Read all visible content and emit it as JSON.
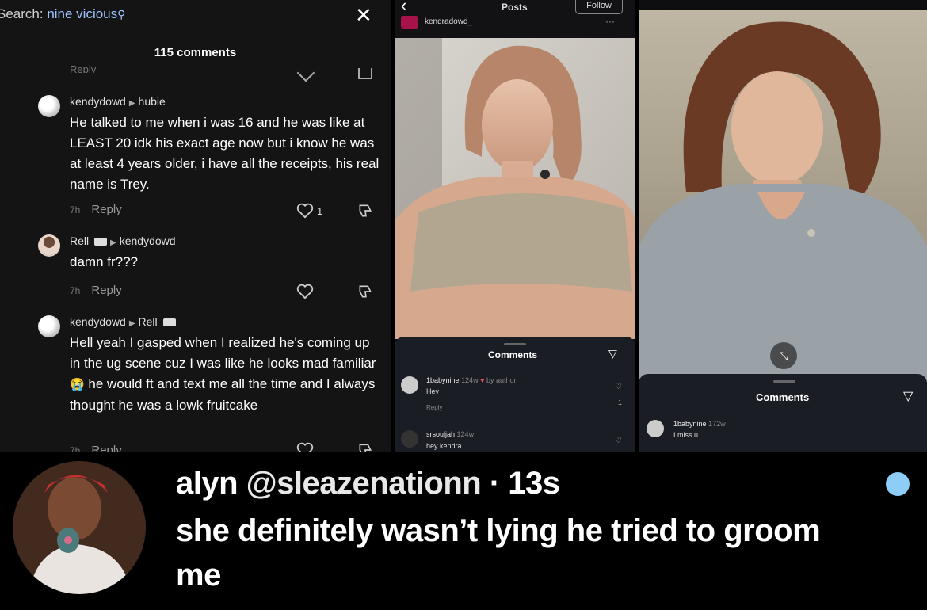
{
  "left_panel": {
    "search_prefix": "Search: ",
    "search_query": "nine vicious",
    "comments_count": "115 comments",
    "cut_off_reply": "Reply",
    "comments": [
      {
        "author": "kendydowd",
        "reply_to": "hubie",
        "text": "He talked to me when i was 16 and he was like at LEAST 20 idk his exact age now but i know he was at least 4 years older, i have all the receipts, his real name is Trey.",
        "time": "7h",
        "reply_label": "Reply",
        "likes": "1"
      },
      {
        "author": "Rell",
        "reply_to": "kendydowd",
        "text": "damn fr???",
        "time": "7h",
        "reply_label": "Reply"
      },
      {
        "author": "kendydowd",
        "reply_to": "Rell",
        "text": "Hell yeah I gasped when I realized he's coming up in the ug scene cuz I was like he looks mad familiar",
        "emoji": "😭",
        "text_cont": " he would ft and text me all the time and I always thought he was a lowk fruitcake",
        "time": "7h",
        "reply_label": "Reply"
      }
    ]
  },
  "middle_panel": {
    "header_title": "Posts",
    "follow_label": "Follow",
    "username": "kendradowd_",
    "sheet_title": "Comments",
    "comments": [
      {
        "user": "1babynine",
        "meta": "124w",
        "by_author": "by author",
        "text": "Hey",
        "reply_label": "Reply",
        "likes": "1"
      },
      {
        "user": "srsouljah",
        "meta": "124w",
        "text": "hey kendra"
      }
    ]
  },
  "right_panel": {
    "sheet_title": "Comments",
    "comments": [
      {
        "user": "1babynine",
        "meta": "172w",
        "text": "I miss u"
      }
    ]
  },
  "tweet": {
    "display_name": "alyn",
    "handle": "@sleazenationn",
    "time": "· 13s",
    "text": "she definitely wasn’t lying he tried to groom me"
  },
  "colors": {
    "accent_blue_dot": "#8ecdf5",
    "search_text": "#9cc4ff",
    "by_author_red": "#e84c5a"
  }
}
